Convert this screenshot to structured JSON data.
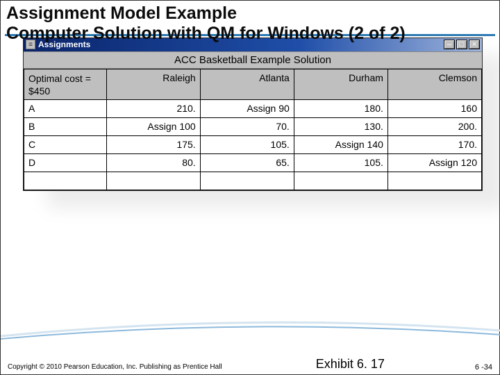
{
  "title_line1": "Assignment Model Example",
  "title_line2": "Computer Solution with QM for Windows (2 of 2)",
  "window": {
    "icon_glyph": "≡",
    "title": "Assignments",
    "min_glyph": "–",
    "max_glyph": "□",
    "close_glyph": "×"
  },
  "sheet": {
    "caption": "ACC Basketball Example Solution",
    "optimal_label": "Optimal cost =",
    "optimal_value": "$450",
    "columns": [
      "Raleigh",
      "Atlanta",
      "Durham",
      "Clemson"
    ],
    "rows": [
      {
        "label": "A",
        "cells": [
          "210.",
          "Assign 90",
          "180.",
          "160"
        ]
      },
      {
        "label": "B",
        "cells": [
          "Assign 100",
          "70.",
          "130.",
          "200."
        ]
      },
      {
        "label": "C",
        "cells": [
          "175.",
          "105.",
          "Assign 140",
          "170."
        ]
      },
      {
        "label": "D",
        "cells": [
          "80.",
          "65.",
          "105.",
          "Assign 120"
        ]
      }
    ]
  },
  "exhibit": "Exhibit 6. 17",
  "copyright": "Copyright © 2010 Pearson Education, Inc. Publishing as Prentice Hall",
  "pagenum": "6 -34",
  "chart_data": {
    "type": "table",
    "title": "ACC Basketball Example Solution",
    "optimal_cost": 450,
    "columns": [
      "Raleigh",
      "Atlanta",
      "Durham",
      "Clemson"
    ],
    "rows": [
      "A",
      "B",
      "C",
      "D"
    ],
    "values": [
      [
        210,
        90,
        180,
        160
      ],
      [
        100,
        70,
        130,
        200
      ],
      [
        175,
        105,
        140,
        170
      ],
      [
        80,
        65,
        105,
        120
      ]
    ],
    "assignment": [
      [
        "A",
        "Atlanta",
        90
      ],
      [
        "B",
        "Raleigh",
        100
      ],
      [
        "C",
        "Durham",
        140
      ],
      [
        "D",
        "Clemson",
        120
      ]
    ]
  }
}
